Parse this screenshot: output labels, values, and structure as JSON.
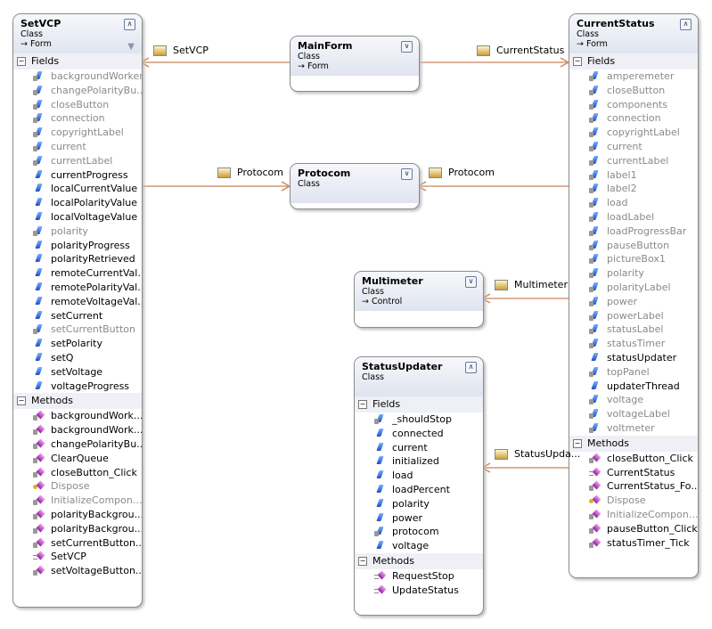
{
  "connector_color": "#c8845a",
  "classes": [
    {
      "id": "setvcp",
      "name": "SetVCP",
      "kind": "Class",
      "base": "Form",
      "filter": true,
      "sections": [
        {
          "title": "Fields",
          "type": "field",
          "items": [
            {
              "n": "backgroundWorker",
              "g": 1,
              "lock": 1
            },
            {
              "n": "changePolarityBu...",
              "g": 1,
              "lock": 1
            },
            {
              "n": "closeButton",
              "g": 1,
              "lock": 1
            },
            {
              "n": "connection",
              "g": 1,
              "lock": 1
            },
            {
              "n": "copyrightLabel",
              "g": 1,
              "lock": 1
            },
            {
              "n": "current",
              "g": 1,
              "lock": 1
            },
            {
              "n": "currentLabel",
              "g": 1,
              "lock": 1
            },
            {
              "n": "currentProgress"
            },
            {
              "n": "localCurrentValue"
            },
            {
              "n": "localPolarityValue"
            },
            {
              "n": "localVoltageValue"
            },
            {
              "n": "polarity",
              "g": 1,
              "lock": 1
            },
            {
              "n": "polarityProgress"
            },
            {
              "n": "polarityRetrieved"
            },
            {
              "n": "remoteCurrentVal..."
            },
            {
              "n": "remotePolarityVal..."
            },
            {
              "n": "remoteVoltageVal..."
            },
            {
              "n": "setCurrent"
            },
            {
              "n": "setCurrentButton",
              "g": 1,
              "lock": 1
            },
            {
              "n": "setPolarity"
            },
            {
              "n": "setQ"
            },
            {
              "n": "setVoltage"
            },
            {
              "n": "voltageProgress"
            }
          ]
        },
        {
          "title": "Methods",
          "type": "method",
          "items": [
            {
              "n": "backgroundWork...",
              "lock": 1
            },
            {
              "n": "backgroundWork...",
              "lock": 1
            },
            {
              "n": "changePolarityBu...",
              "lock": 1
            },
            {
              "n": "ClearQueue",
              "lock": 1
            },
            {
              "n": "closeButton_Click",
              "lock": 1
            },
            {
              "n": "Dispose",
              "g": 1,
              "key": 1
            },
            {
              "n": "InitializeCompon...",
              "g": 1,
              "lock": 1
            },
            {
              "n": "polarityBackgrou...",
              "lock": 1
            },
            {
              "n": "polarityBackgrou...",
              "lock": 1
            },
            {
              "n": "setCurrentButton...",
              "lock": 1
            },
            {
              "n": "SetVCP",
              "ctor": 1
            },
            {
              "n": "setVoltageButton...",
              "lock": 1
            }
          ]
        }
      ]
    },
    {
      "id": "mainform",
      "name": "MainForm",
      "kind": "Class",
      "base": "Form",
      "collapsed": true,
      "sections": []
    },
    {
      "id": "protocom",
      "name": "Protocom",
      "kind": "Class",
      "collapsed": true,
      "sections": []
    },
    {
      "id": "multimeter",
      "name": "Multimeter",
      "kind": "Class",
      "base": "Control",
      "collapsed": true,
      "sections": []
    },
    {
      "id": "statusupdater",
      "name": "StatusUpdater",
      "kind": "Class",
      "sections": [
        {
          "title": "Fields",
          "type": "field",
          "items": [
            {
              "n": "_shouldStop",
              "lock": 1
            },
            {
              "n": "connected"
            },
            {
              "n": "current"
            },
            {
              "n": "initialized"
            },
            {
              "n": "load"
            },
            {
              "n": "loadPercent"
            },
            {
              "n": "polarity"
            },
            {
              "n": "power"
            },
            {
              "n": "protocom",
              "lock": 1
            },
            {
              "n": "voltage"
            }
          ]
        },
        {
          "title": "Methods",
          "type": "method",
          "items": [
            {
              "n": "RequestStop",
              "ctor": 1
            },
            {
              "n": "UpdateStatus",
              "ctor": 1
            }
          ]
        }
      ]
    },
    {
      "id": "currentstatus",
      "name": "CurrentStatus",
      "kind": "Class",
      "base": "Form",
      "sections": [
        {
          "title": "Fields",
          "type": "field",
          "items": [
            {
              "n": "amperemeter",
              "g": 1,
              "lock": 1
            },
            {
              "n": "closeButton",
              "g": 1,
              "lock": 1
            },
            {
              "n": "components",
              "g": 1,
              "lock": 1
            },
            {
              "n": "connection",
              "g": 1,
              "lock": 1
            },
            {
              "n": "copyrightLabel",
              "g": 1,
              "lock": 1
            },
            {
              "n": "current",
              "g": 1,
              "lock": 1
            },
            {
              "n": "currentLabel",
              "g": 1,
              "lock": 1
            },
            {
              "n": "label1",
              "g": 1,
              "lock": 1
            },
            {
              "n": "label2",
              "g": 1,
              "lock": 1
            },
            {
              "n": "load",
              "g": 1,
              "lock": 1
            },
            {
              "n": "loadLabel",
              "g": 1,
              "lock": 1
            },
            {
              "n": "loadProgressBar",
              "g": 1,
              "lock": 1
            },
            {
              "n": "pauseButton",
              "g": 1,
              "lock": 1
            },
            {
              "n": "pictureBox1",
              "g": 1,
              "lock": 1
            },
            {
              "n": "polarity",
              "g": 1,
              "lock": 1
            },
            {
              "n": "polarityLabel",
              "g": 1,
              "lock": 1
            },
            {
              "n": "power",
              "g": 1,
              "lock": 1
            },
            {
              "n": "powerLabel",
              "g": 1,
              "lock": 1
            },
            {
              "n": "statusLabel",
              "g": 1,
              "lock": 1
            },
            {
              "n": "statusTimer",
              "g": 1,
              "lock": 1
            },
            {
              "n": "statusUpdater"
            },
            {
              "n": "topPanel",
              "g": 1,
              "lock": 1
            },
            {
              "n": "updaterThread"
            },
            {
              "n": "voltage",
              "g": 1,
              "lock": 1
            },
            {
              "n": "voltageLabel",
              "g": 1,
              "lock": 1
            },
            {
              "n": "voltmeter",
              "g": 1,
              "lock": 1
            }
          ]
        },
        {
          "title": "Methods",
          "type": "method",
          "items": [
            {
              "n": "closeButton_Click",
              "lock": 1
            },
            {
              "n": "CurrentStatus",
              "ctor": 1
            },
            {
              "n": "CurrentStatus_Fo...",
              "lock": 1
            },
            {
              "n": "Dispose",
              "g": 1,
              "key": 1
            },
            {
              "n": "InitializeCompon...",
              "g": 1,
              "lock": 1
            },
            {
              "n": "pauseButton_Click",
              "lock": 1
            },
            {
              "n": "statusTimer_Tick",
              "lock": 1
            }
          ]
        }
      ]
    }
  ],
  "associations": [
    {
      "label": "SetVCP"
    },
    {
      "label": "CurrentStatus"
    },
    {
      "label": "Protocom"
    },
    {
      "label": "Protocom"
    },
    {
      "label": "Multimeter"
    },
    {
      "label": "StatusUpda..."
    }
  ]
}
